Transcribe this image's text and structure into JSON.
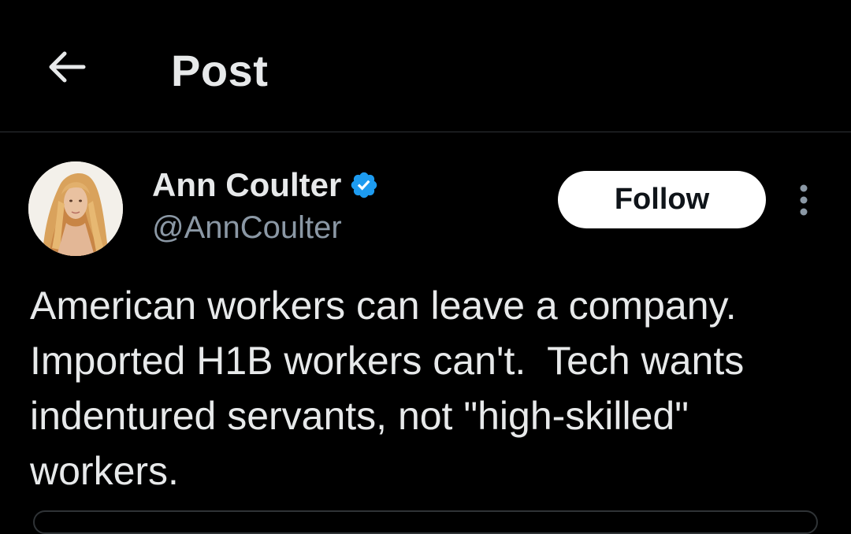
{
  "header": {
    "back_icon": "arrow-left-icon",
    "title": "Post"
  },
  "author": {
    "name": "Ann Coulter",
    "handle": "@AnnCoulter",
    "verified_icon": "verified-badge-icon",
    "verified_color": "#1d9bf0",
    "avatar_icon": "profile-photo"
  },
  "actions": {
    "follow_label": "Follow",
    "more_icon": "more-vertical-icon"
  },
  "post": {
    "text": "American workers can leave a company. Imported H1B workers can't.  Tech wants indentured servants, not \"high-skilled\" workers."
  },
  "colors": {
    "background": "#000000",
    "text_primary": "#e7e9ea",
    "text_secondary": "#8b98a5",
    "divider": "#2f3336",
    "follow_bg": "#ffffff",
    "follow_text": "#0f1419"
  }
}
